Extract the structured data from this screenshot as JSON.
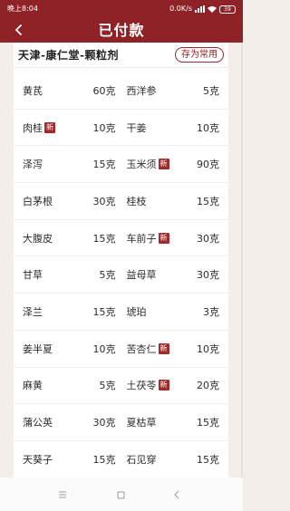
{
  "status_bar": {
    "time": "晚上8:04",
    "net_speed": "0.0K/s",
    "battery": "39"
  },
  "header": {
    "title": "已付款"
  },
  "prescription": {
    "name": "天津-康仁堂-颗粒剂",
    "save_label": "存为常用",
    "new_badge": "新",
    "rows": [
      [
        {
          "name": "黄芪",
          "dose": "60克",
          "new": false
        },
        {
          "name": "西洋参",
          "dose": "5克",
          "new": false
        }
      ],
      [
        {
          "name": "肉桂",
          "dose": "10克",
          "new": true
        },
        {
          "name": "干姜",
          "dose": "10克",
          "new": false
        }
      ],
      [
        {
          "name": "泽泻",
          "dose": "15克",
          "new": false
        },
        {
          "name": "玉米须",
          "dose": "90克",
          "new": true
        }
      ],
      [
        {
          "name": "白茅根",
          "dose": "30克",
          "new": false
        },
        {
          "name": "桂枝",
          "dose": "15克",
          "new": false
        }
      ],
      [
        {
          "name": "大腹皮",
          "dose": "15克",
          "new": false
        },
        {
          "name": "车前子",
          "dose": "30克",
          "new": true
        }
      ],
      [
        {
          "name": "甘草",
          "dose": "5克",
          "new": false
        },
        {
          "name": "益母草",
          "dose": "30克",
          "new": false
        }
      ],
      [
        {
          "name": "泽兰",
          "dose": "15克",
          "new": false
        },
        {
          "name": "琥珀",
          "dose": "3克",
          "new": false
        }
      ],
      [
        {
          "name": "姜半夏",
          "dose": "10克",
          "new": false
        },
        {
          "name": "苦杏仁",
          "dose": "10克",
          "new": true
        }
      ],
      [
        {
          "name": "麻黄",
          "dose": "5克",
          "new": false
        },
        {
          "name": "土茯苓",
          "dose": "20克",
          "new": true
        }
      ],
      [
        {
          "name": "蒲公英",
          "dose": "30克",
          "new": false
        },
        {
          "name": "夏枯草",
          "dose": "15克",
          "new": false
        }
      ],
      [
        {
          "name": "天葵子",
          "dose": "15克",
          "new": false
        },
        {
          "name": "石见穿",
          "dose": "15克",
          "new": false
        }
      ]
    ]
  },
  "colors": {
    "brand": "#8f2226",
    "badge": "#a12a2a",
    "background": "#f3eeea"
  },
  "icons": {
    "back": "chevron-left-icon",
    "menu": "menu-icon",
    "home": "home-square-icon",
    "system_back": "triangle-back-icon"
  }
}
